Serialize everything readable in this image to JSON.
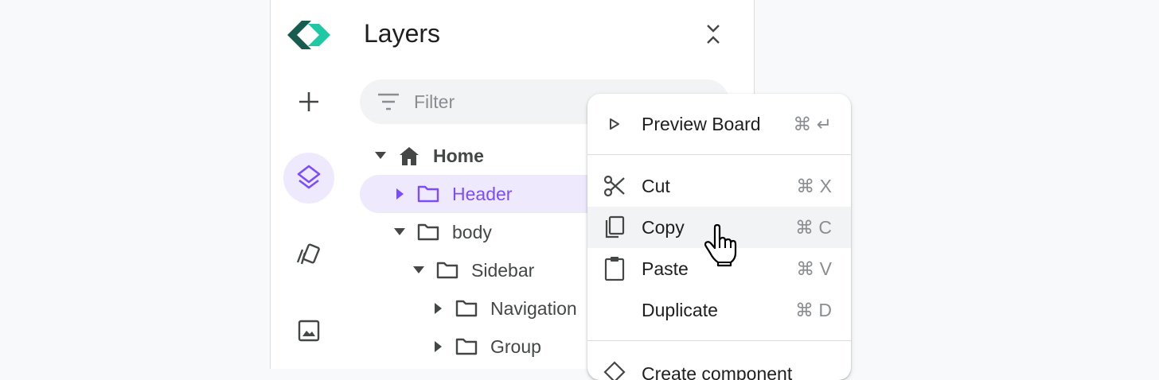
{
  "panel": {
    "title": "Layers",
    "filter_placeholder": "Filter"
  },
  "rail": {
    "items": [
      {
        "icon": "add-icon"
      },
      {
        "icon": "layers-icon",
        "active": true
      },
      {
        "icon": "components-icon"
      },
      {
        "icon": "image-icon"
      }
    ]
  },
  "tree": {
    "home": "Home",
    "header": "Header",
    "body": "body",
    "sidebar": "Sidebar",
    "navigation": "Navigation",
    "group": "Group"
  },
  "context_menu": {
    "preview": {
      "label": "Preview Board",
      "shortcut": "⌘ ↵"
    },
    "cut": {
      "label": "Cut",
      "shortcut": "⌘ X"
    },
    "copy": {
      "label": "Copy",
      "shortcut": "⌘ C"
    },
    "paste": {
      "label": "Paste",
      "shortcut": "⌘ V"
    },
    "duplicate": {
      "label": "Duplicate",
      "shortcut": "⌘ D"
    },
    "create_component": {
      "label": "Create component"
    }
  },
  "colors": {
    "accent": "#7c4dff",
    "selected_bg": "#efe9fd",
    "logo_dark": "#185c4f",
    "logo_light": "#1ec8a5"
  }
}
